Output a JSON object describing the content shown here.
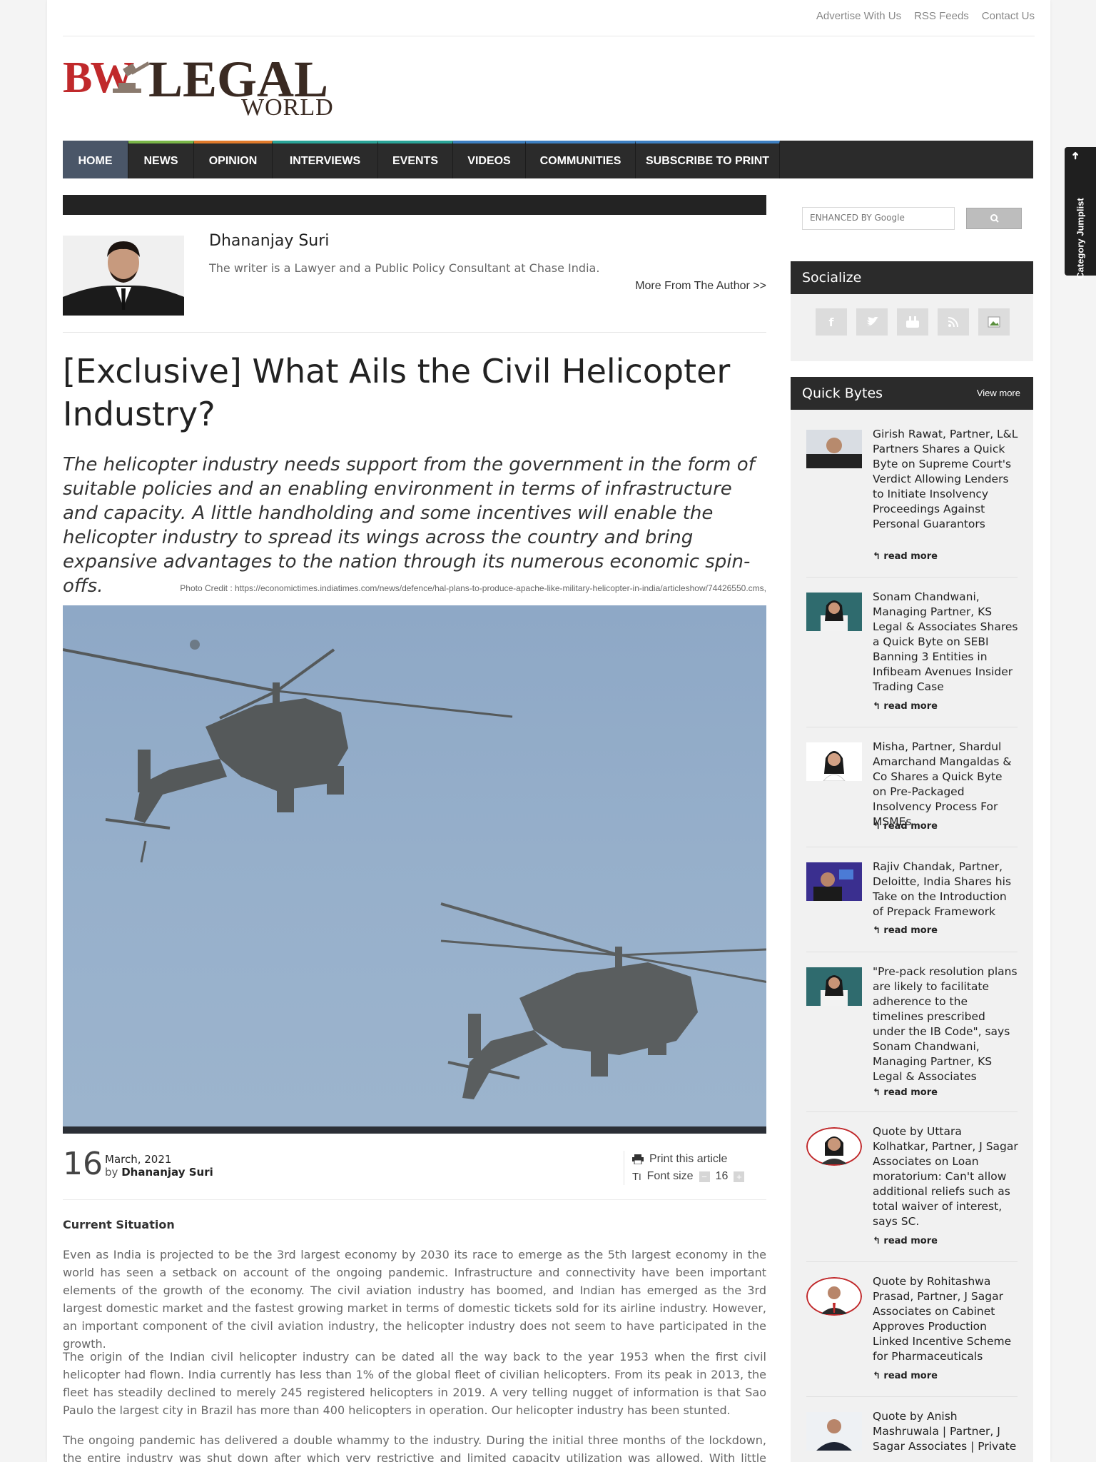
{
  "top_links": [
    "Advertise With Us",
    "RSS Feeds",
    "Contact Us"
  ],
  "logo": {
    "bw": "BW",
    "legal": "LEGAL",
    "world": "WORLD"
  },
  "nav": [
    {
      "label": "HOME",
      "color": "#4a5668"
    },
    {
      "label": "NEWS",
      "color": "#7ab648"
    },
    {
      "label": "OPINION",
      "color": "#e07a2b"
    },
    {
      "label": "INTERVIEWS",
      "color": "#2aa397"
    },
    {
      "label": "EVENTS",
      "color": "#2aa397"
    },
    {
      "label": "VIDEOS",
      "color": "#3d7fc1"
    },
    {
      "label": "COMMUNITIES",
      "color": "#3d7fc1"
    },
    {
      "label": "SUBSCRIBE TO PRINT",
      "color": "#3d7fc1"
    }
  ],
  "author": {
    "name": "Dhananjay Suri",
    "description": "The writer is a Lawyer and a Public Policy Consultant at Chase India.",
    "more_link": "More From The Author >>"
  },
  "article": {
    "title": "[Exclusive] What Ails the Civil Helicopter Industry?",
    "lead": "The helicopter industry needs support from the government in the form of suitable policies and an enabling environment in terms of infrastructure and capacity. A little handholding and some incentives will enable the helicopter industry to spread its wings across the country and bring expansive advantages to the nation through its numerous economic spin-offs.",
    "photo_credit": "Photo Credit : https://economictimes.indiatimes.com/news/defence/hal-plans-to-produce-apache-like-military-helicopter-in-india/articleshow/74426550.cms,",
    "day": "16",
    "month_year": "March, 2021",
    "by": "by",
    "by_author": "Dhananjay Suri",
    "print_label": "Print this article",
    "font_size_label": "Font size",
    "font_size_value": "16",
    "section_heading": "Current Situation",
    "paragraphs": [
      "Even as India is projected to be the 3rd largest economy by 2030 its race to emerge as the 5th largest economy in the world has seen a setback on account of the ongoing pandemic. Infrastructure and connectivity have been important elements of the growth of the economy. The civil aviation industry has boomed, and Indian has emerged as the 3rd largest domestic market and the fastest growing market in terms of domestic tickets sold for its airline industry. However, an important component of the civil aviation industry, the helicopter industry does not seem to have participated in the growth.",
      "The origin of the Indian civil helicopter industry can be dated all the way back to the year 1953 when the first civil helicopter had flown. India currently has less than 1% of the global fleet of civilian helicopters. From its peak in 2013, the fleet has steadily declined to merely 245 registered helicopters in 2019. A very telling nugget of information is that Sao Paulo the largest city in Brazil has more than 400 helicopters in operation. Our helicopter industry has been stunted.",
      "The ongoing pandemic has delivered a double whammy to the industry. During the initial three months of the lockdown, the entire industry was shut down after which very restrictive and limited capacity utilization was allowed. With little revenue and"
    ]
  },
  "sidebar": {
    "search_placeholder": "ENHANCED BY Google",
    "socialize_title": "Socialize",
    "social_icons": [
      "f",
      "t",
      "yt",
      "rss",
      "img"
    ],
    "quick_bytes_title": "Quick Bytes",
    "view_more": "View more",
    "read_more": "read more",
    "items": [
      "Girish Rawat, Partner, L&L Partners Shares a Quick Byte on Supreme Court's Verdict Allowing Lenders to Initiate Insolvency Proceedings Against Personal Guarantors",
      "Sonam Chandwani, Managing Partner, KS Legal & Associates Shares a Quick Byte on SEBI Banning 3 Entities in Infibeam Avenues Insider Trading Case",
      "Misha, Partner, Shardul Amarchand Mangaldas & Co Shares a Quick Byte on Pre-Packaged Insolvency Process For MSMEs",
      "Rajiv Chandak, Partner, Deloitte, India Shares his Take on the Introduction of Prepack Framework",
      "\"Pre-pack resolution plans are likely to facilitate adherence to the timelines prescribed under the IB Code\", says Sonam Chandwani, Managing Partner, KS Legal & Associates",
      "Quote by Uttara Kolhatkar, Partner, J Sagar Associates on Loan moratorium: Can't allow additional reliefs such as total waiver of interest, says SC.",
      "Quote by Rohitashwa Prasad, Partner, J Sagar Associates on Cabinet Approves Production Linked Incentive Scheme for Pharmaceuticals",
      "Quote by Anish Mashruwala | Partner, J Sagar Associates | Private"
    ]
  },
  "jumplist_label": "Category Jumplist"
}
